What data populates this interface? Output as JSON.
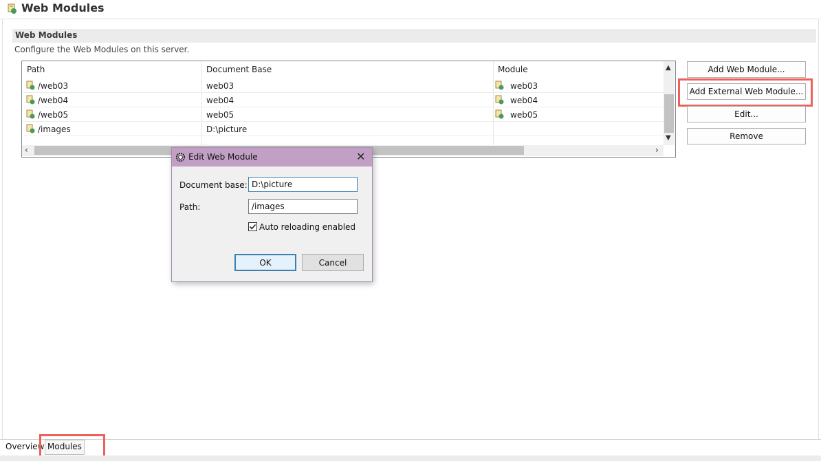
{
  "editor": {
    "title": "Web Modules",
    "title_icon": "server-module-icon"
  },
  "section": {
    "title": "Web Modules",
    "description": "Configure the Web Modules on this server."
  },
  "table": {
    "columns": [
      "Path",
      "Document Base",
      "Module"
    ],
    "rows": [
      {
        "path": "/web03",
        "document_base": "web03",
        "module": "web03"
      },
      {
        "path": "/web04",
        "document_base": "web04",
        "module": "web04"
      },
      {
        "path": "/web05",
        "document_base": "web05",
        "module": "web05"
      },
      {
        "path": "/images",
        "document_base": "D:\\picture",
        "module": ""
      }
    ]
  },
  "buttons": {
    "add_web_module": "Add Web Module...",
    "add_external_web_module": "Add External Web Module...",
    "edit": "Edit...",
    "remove": "Remove"
  },
  "dialog": {
    "title": "Edit Web Module",
    "document_base_label": "Document base:",
    "document_base_value": "D:\\picture",
    "path_label": "Path:",
    "path_value": "/images",
    "auto_reload_label": "Auto reloading enabled",
    "auto_reload_checked": true,
    "ok_label": "OK",
    "cancel_label": "Cancel"
  },
  "tabs": {
    "overview": "Overview",
    "modules": "Modules",
    "active": "Modules"
  },
  "colors": {
    "highlight": "#ec6159",
    "dialog_title_bar": "#c2a0c6",
    "section_bar": "#ececec"
  }
}
